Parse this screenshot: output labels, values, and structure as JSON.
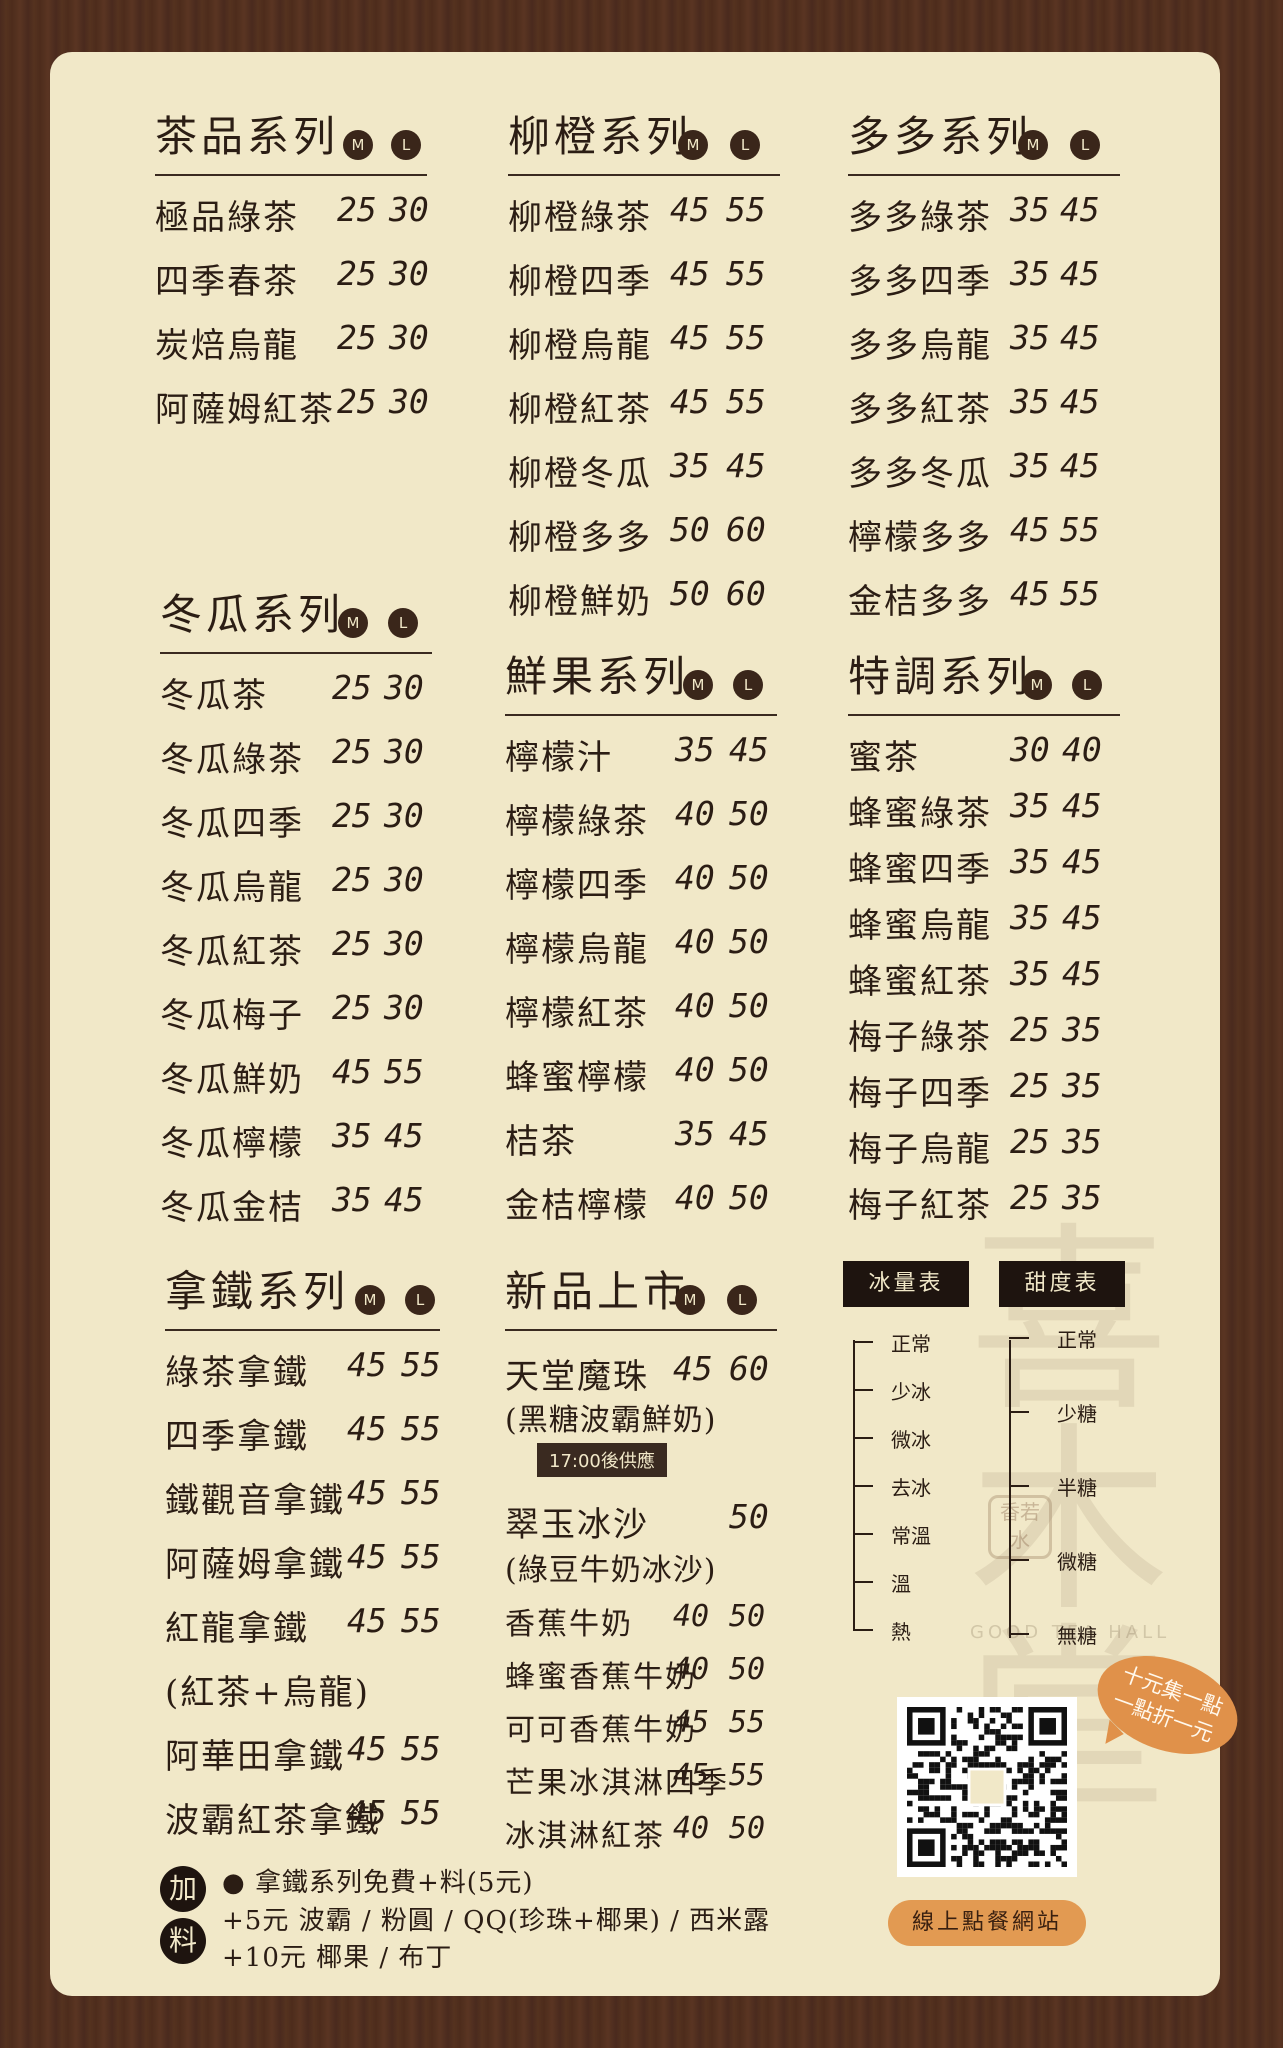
{
  "sections": {
    "tea": {
      "title": "茶品系列",
      "m": "M",
      "l": "L",
      "items": [
        {
          "name": "極品綠茶",
          "m": "25",
          "l": "30"
        },
        {
          "name": "四季春茶",
          "m": "25",
          "l": "30"
        },
        {
          "name": "炭焙烏龍",
          "m": "25",
          "l": "30"
        },
        {
          "name": "阿薩姆紅茶",
          "m": "25",
          "l": "30"
        }
      ]
    },
    "orange": {
      "title": "柳橙系列",
      "m": "M",
      "l": "L",
      "items": [
        {
          "name": "柳橙綠茶",
          "m": "45",
          "l": "55"
        },
        {
          "name": "柳橙四季",
          "m": "45",
          "l": "55"
        },
        {
          "name": "柳橙烏龍",
          "m": "45",
          "l": "55"
        },
        {
          "name": "柳橙紅茶",
          "m": "45",
          "l": "55"
        },
        {
          "name": "柳橙冬瓜",
          "m": "35",
          "l": "45"
        },
        {
          "name": "柳橙多多",
          "m": "50",
          "l": "60"
        },
        {
          "name": "柳橙鮮奶",
          "m": "50",
          "l": "60"
        }
      ]
    },
    "yakult": {
      "title": "多多系列",
      "m": "M",
      "l": "L",
      "items": [
        {
          "name": "多多綠茶",
          "m": "35",
          "l": "45"
        },
        {
          "name": "多多四季",
          "m": "35",
          "l": "45"
        },
        {
          "name": "多多烏龍",
          "m": "35",
          "l": "45"
        },
        {
          "name": "多多紅茶",
          "m": "35",
          "l": "45"
        },
        {
          "name": "多多冬瓜",
          "m": "35",
          "l": "45"
        },
        {
          "name": "檸檬多多",
          "m": "45",
          "l": "55"
        },
        {
          "name": "金桔多多",
          "m": "45",
          "l": "55"
        }
      ]
    },
    "melon": {
      "title": "冬瓜系列",
      "m": "M",
      "l": "L",
      "items": [
        {
          "name": "冬瓜茶",
          "m": "25",
          "l": "30"
        },
        {
          "name": "冬瓜綠茶",
          "m": "25",
          "l": "30"
        },
        {
          "name": "冬瓜四季",
          "m": "25",
          "l": "30"
        },
        {
          "name": "冬瓜烏龍",
          "m": "25",
          "l": "30"
        },
        {
          "name": "冬瓜紅茶",
          "m": "25",
          "l": "30"
        },
        {
          "name": "冬瓜梅子",
          "m": "25",
          "l": "30"
        },
        {
          "name": "冬瓜鮮奶",
          "m": "45",
          "l": "55"
        },
        {
          "name": "冬瓜檸檬",
          "m": "35",
          "l": "45"
        },
        {
          "name": "冬瓜金桔",
          "m": "35",
          "l": "45"
        }
      ]
    },
    "fruit": {
      "title": "鮮果系列",
      "m": "M",
      "l": "L",
      "items": [
        {
          "name": "檸檬汁",
          "m": "35",
          "l": "45"
        },
        {
          "name": "檸檬綠茶",
          "m": "40",
          "l": "50"
        },
        {
          "name": "檸檬四季",
          "m": "40",
          "l": "50"
        },
        {
          "name": "檸檬烏龍",
          "m": "40",
          "l": "50"
        },
        {
          "name": "檸檬紅茶",
          "m": "40",
          "l": "50"
        },
        {
          "name": "蜂蜜檸檬",
          "m": "40",
          "l": "50"
        },
        {
          "name": "桔茶",
          "m": "35",
          "l": "45"
        },
        {
          "name": "金桔檸檬",
          "m": "40",
          "l": "50"
        }
      ]
    },
    "special": {
      "title": "特調系列",
      "m": "M",
      "l": "L",
      "items": [
        {
          "name": "蜜茶",
          "m": "30",
          "l": "40"
        },
        {
          "name": "蜂蜜綠茶",
          "m": "35",
          "l": "45"
        },
        {
          "name": "蜂蜜四季",
          "m": "35",
          "l": "45"
        },
        {
          "name": "蜂蜜烏龍",
          "m": "35",
          "l": "45"
        },
        {
          "name": "蜂蜜紅茶",
          "m": "35",
          "l": "45"
        },
        {
          "name": "梅子綠茶",
          "m": "25",
          "l": "35"
        },
        {
          "name": "梅子四季",
          "m": "25",
          "l": "35"
        },
        {
          "name": "梅子烏龍",
          "m": "25",
          "l": "35"
        },
        {
          "name": "梅子紅茶",
          "m": "25",
          "l": "35"
        }
      ]
    },
    "latte": {
      "title": "拿鐵系列",
      "m": "M",
      "l": "L",
      "items": [
        {
          "name": "綠茶拿鐵",
          "m": "45",
          "l": "55"
        },
        {
          "name": "四季拿鐵",
          "m": "45",
          "l": "55"
        },
        {
          "name": "鐵觀音拿鐵",
          "m": "45",
          "l": "55"
        },
        {
          "name": "阿薩姆拿鐵",
          "m": "45",
          "l": "55"
        },
        {
          "name": "紅龍拿鐵",
          "m": "45",
          "l": "55",
          "sub": "(紅茶+烏龍)"
        },
        {
          "name": "阿華田拿鐵",
          "m": "45",
          "l": "55"
        },
        {
          "name": "波霸紅茶拿鐵",
          "m": "45",
          "l": "55"
        }
      ]
    },
    "new": {
      "title": "新品上市",
      "m": "M",
      "l": "L",
      "heaven": {
        "name": "天堂魔珠",
        "m": "45",
        "l": "60",
        "sub": "(黑糖波霸鮮奶)",
        "tag": "17:00後供應"
      },
      "jade": {
        "name": "翠玉冰沙",
        "l": "50",
        "sub": "(綠豆牛奶冰沙)"
      },
      "items": [
        {
          "name": "香蕉牛奶",
          "m": "40",
          "l": "50"
        },
        {
          "name": "蜂蜜香蕉牛奶",
          "m": "40",
          "l": "50"
        },
        {
          "name": "可可香蕉牛奶",
          "m": "45",
          "l": "55"
        },
        {
          "name": "芒果冰淇淋四季",
          "m": "45",
          "l": "55"
        },
        {
          "name": "冰淇淋紅茶",
          "m": "40",
          "l": "50"
        }
      ]
    }
  },
  "ice_table": {
    "title": "冰量表",
    "levels": [
      "正常",
      "少冰",
      "微冰",
      "去冰",
      "常溫",
      "溫",
      "熱"
    ]
  },
  "sugar_table": {
    "title": "甜度表",
    "levels": [
      "正常",
      "少糖",
      "半糖",
      "微糖",
      "無糖"
    ]
  },
  "brand": {
    "watermark": "喜木堂",
    "seal": "香若水",
    "english": "GOOD TEA HALL"
  },
  "promo_bubble": {
    "line1": "十元集一點",
    "line2": "一點折一元"
  },
  "online_order": "線上點餐網站",
  "addons": {
    "char1": "加",
    "char2": "料",
    "line1": "● 拿鐵系列免費+料(5元)",
    "line2": "+5元 波霸 / 粉圓 / QQ(珍珠+椰果) / 西米露",
    "line3": "+10元 椰果 / 布丁"
  }
}
